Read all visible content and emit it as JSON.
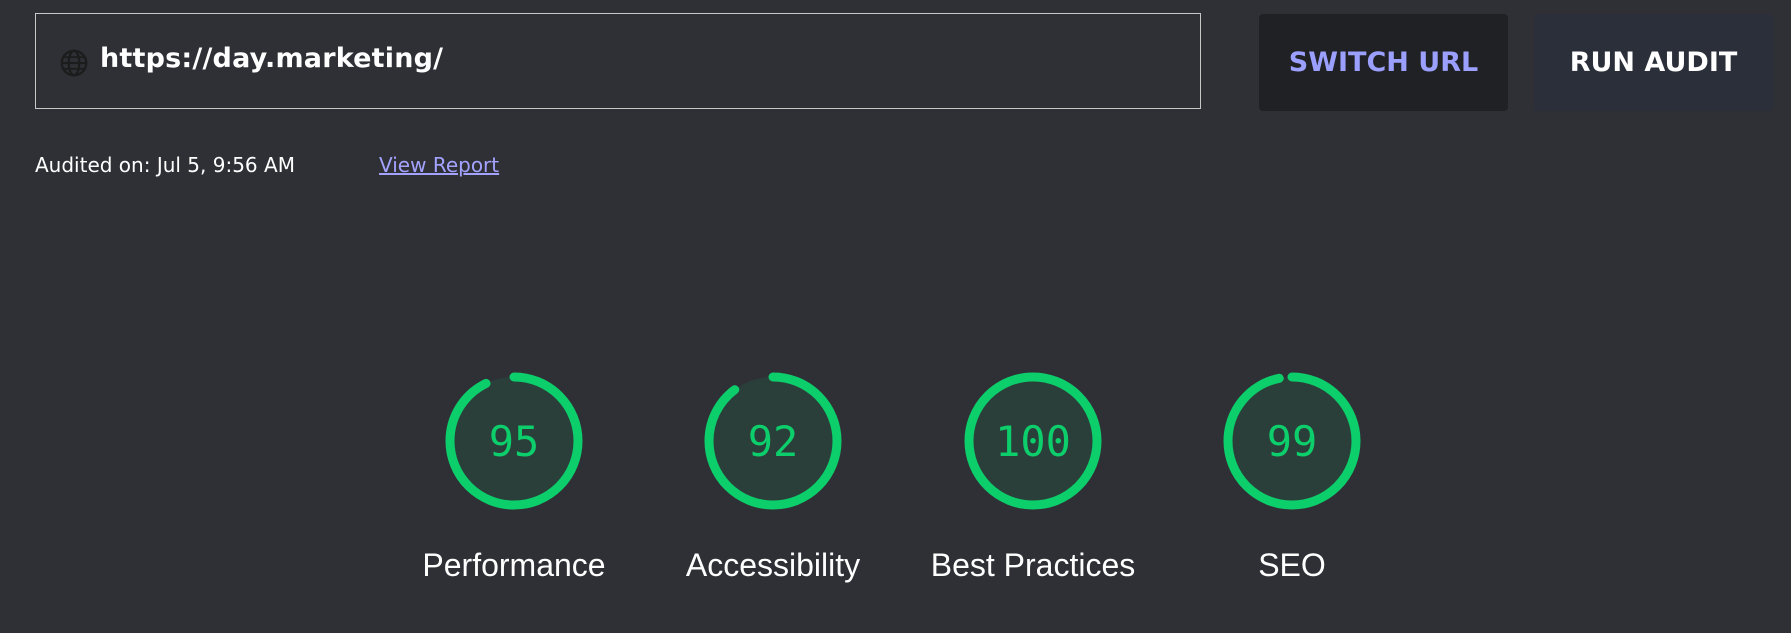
{
  "url_bar": {
    "icon": "globe-icon",
    "value": "https://day.marketing/"
  },
  "buttons": {
    "switch_url": "SWITCH URL",
    "run_audit": "RUN AUDIT"
  },
  "audit_info": {
    "audited_on": "Audited on: Jul 5, 9:56 AM",
    "view_report": "View Report"
  },
  "colors": {
    "background": "#2f3036",
    "pass_green": "#0cce6b",
    "gauge_fill": "#2a3f3a",
    "accent": "#9ba0ff"
  },
  "scores": [
    {
      "label": "Performance",
      "value": 95
    },
    {
      "label": "Accessibility",
      "value": 92
    },
    {
      "label": "Best Practices",
      "value": 100
    },
    {
      "label": "SEO",
      "value": 99
    }
  ]
}
